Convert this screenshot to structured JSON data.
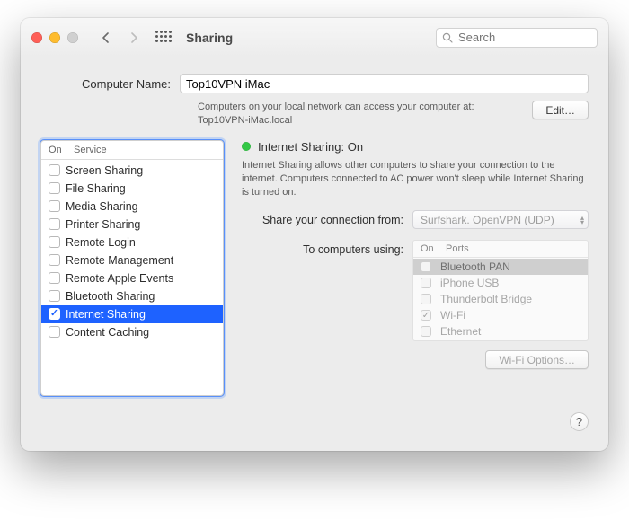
{
  "titlebar": {
    "title": "Sharing",
    "search_placeholder": "Search"
  },
  "computer_name": {
    "label": "Computer Name:",
    "value": "Top10VPN iMac",
    "help_line1": "Computers on your local network can access your computer at:",
    "help_line2": "Top10VPN-iMac.local",
    "edit_label": "Edit…"
  },
  "services": {
    "col_on": "On",
    "col_service": "Service",
    "items": [
      {
        "label": "Screen Sharing",
        "checked": false
      },
      {
        "label": "File Sharing",
        "checked": false
      },
      {
        "label": "Media Sharing",
        "checked": false
      },
      {
        "label": "Printer Sharing",
        "checked": false
      },
      {
        "label": "Remote Login",
        "checked": false
      },
      {
        "label": "Remote Management",
        "checked": false
      },
      {
        "label": "Remote Apple Events",
        "checked": false
      },
      {
        "label": "Bluetooth Sharing",
        "checked": false
      },
      {
        "label": "Internet Sharing",
        "checked": true
      },
      {
        "label": "Content Caching",
        "checked": false
      }
    ]
  },
  "detail": {
    "status_label": "Internet Sharing: On",
    "status_color": "#33c846",
    "description": "Internet Sharing allows other computers to share your connection to the internet. Computers connected to AC power won't sleep while Internet Sharing is turned on.",
    "share_from_label": "Share your connection from:",
    "share_from_value": "Surfshark. OpenVPN (UDP)",
    "to_computers_label": "To computers using:",
    "ports_col_on": "On",
    "ports_col_ports": "Ports",
    "ports": [
      {
        "label": "Bluetooth PAN",
        "checked": false,
        "selected": true
      },
      {
        "label": "iPhone USB",
        "checked": false,
        "selected": false
      },
      {
        "label": "Thunderbolt Bridge",
        "checked": false,
        "selected": false
      },
      {
        "label": "Wi-Fi",
        "checked": true,
        "selected": false
      },
      {
        "label": "Ethernet",
        "checked": false,
        "selected": false
      }
    ],
    "wifi_options_label": "Wi-Fi Options…"
  }
}
